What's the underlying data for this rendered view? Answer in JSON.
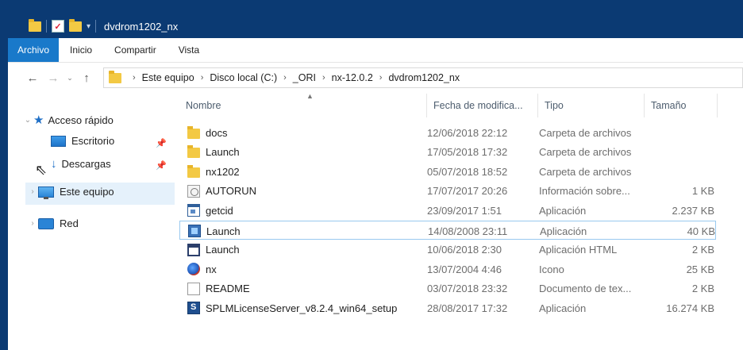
{
  "window": {
    "title": "dvdrom1202_nx"
  },
  "ribbon": {
    "tabs": [
      {
        "label": "Archivo",
        "active": true
      },
      {
        "label": "Inicio",
        "active": false
      },
      {
        "label": "Compartir",
        "active": false
      },
      {
        "label": "Vista",
        "active": false
      }
    ]
  },
  "address": {
    "path": [
      "Este equipo",
      "Disco local (C:)",
      "_ORI",
      "nx-12.0.2",
      "dvdrom1202_nx"
    ]
  },
  "nav": {
    "quick_access": "Acceso rápido",
    "desktop": "Escritorio",
    "downloads": "Descargas",
    "this_pc": "Este equipo",
    "network": "Red"
  },
  "columns": {
    "name": "Nombre",
    "date": "Fecha de modifica...",
    "type": "Tipo",
    "size": "Tamaño"
  },
  "files": [
    {
      "name": "docs",
      "date": "12/06/2018 22:12",
      "type": "Carpeta de archivos",
      "size": "",
      "icon": "folder-icon"
    },
    {
      "name": "Launch",
      "date": "17/05/2018 17:32",
      "type": "Carpeta de archivos",
      "size": "",
      "icon": "folder-icon"
    },
    {
      "name": "nx1202",
      "date": "05/07/2018 18:52",
      "type": "Carpeta de archivos",
      "size": "",
      "icon": "folder-icon"
    },
    {
      "name": "AUTORUN",
      "date": "17/07/2017 20:26",
      "type": "Información sobre...",
      "size": "1 KB",
      "icon": "setup-info-icon"
    },
    {
      "name": "getcid",
      "date": "23/09/2017 1:51",
      "type": "Aplicación",
      "size": "2.237 KB",
      "icon": "application-icon"
    },
    {
      "name": "Launch",
      "date": "14/08/2008 23:11",
      "type": "Aplicación",
      "size": "40 KB",
      "icon": "launch-app-icon"
    },
    {
      "name": "Launch",
      "date": "10/06/2018 2:30",
      "type": "Aplicación HTML",
      "size": "2 KB",
      "icon": "html-application-icon"
    },
    {
      "name": "nx",
      "date": "13/07/2004 4:46",
      "type": "Icono",
      "size": "25 KB",
      "icon": "nx-icon-file-icon"
    },
    {
      "name": "README",
      "date": "03/07/2018 23:32",
      "type": "Documento de tex...",
      "size": "2 KB",
      "icon": "text-document-icon"
    },
    {
      "name": "SPLMLicenseServer_v8.2.4_win64_setup",
      "date": "28/08/2017 17:32",
      "type": "Aplicación",
      "size": "16.274 KB",
      "icon": "installer-icon"
    }
  ],
  "selected_index": 5
}
